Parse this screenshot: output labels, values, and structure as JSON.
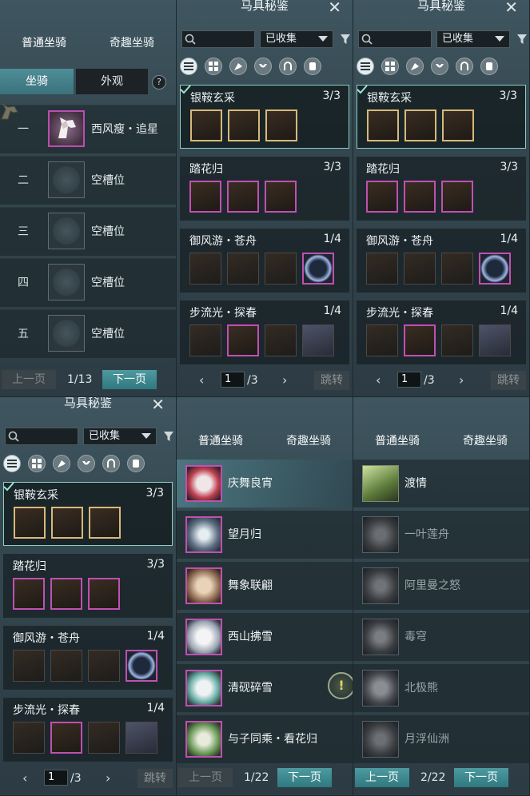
{
  "mount_list": {
    "tabs": [
      "普通坐骑",
      "奇趣坐骑"
    ],
    "sub_tabs": [
      "坐骑",
      "外观"
    ],
    "help": "?",
    "slots": [
      {
        "num": "一",
        "label": "西风瘦・追星",
        "filled": true
      },
      {
        "num": "二",
        "label": "空槽位",
        "filled": false
      },
      {
        "num": "三",
        "label": "空槽位",
        "filled": false
      },
      {
        "num": "四",
        "label": "空槽位",
        "filled": false
      },
      {
        "num": "五",
        "label": "空槽位",
        "filled": false
      }
    ],
    "pager": {
      "prev": "上一页",
      "page": "1/13",
      "next": "下一页"
    }
  },
  "codex": {
    "title": "马具秘鉴",
    "close": "✕",
    "filter_value": "已收集",
    "sets": [
      {
        "name": "银鞍玄采",
        "count": "3/3",
        "selected": true
      },
      {
        "name": "踏花归",
        "count": "3/3",
        "selected": false
      },
      {
        "name": "御风游・苍舟",
        "count": "1/4",
        "selected": false
      },
      {
        "name": "步流光・探春",
        "count": "1/4",
        "selected": false
      }
    ],
    "pager": {
      "page": "1",
      "total": "/3",
      "jump": "跳转"
    }
  },
  "mounts_page1": {
    "tabs": [
      "普通坐骑",
      "奇趣坐骑"
    ],
    "items": [
      "庆舞良宵",
      "望月归",
      "舞象联翩",
      "西山拂雪",
      "清砚碎雪",
      "与子同乘・看花归"
    ],
    "alert": "!",
    "pager": {
      "prev": "上一页",
      "page": "1/22",
      "next": "下一页"
    }
  },
  "mounts_page2": {
    "tabs": [
      "普通坐骑",
      "奇趣坐骑"
    ],
    "items": [
      "渡情",
      "一叶莲舟",
      "阿里曼之怒",
      "毒穹",
      "北极熊",
      "月浮仙洲"
    ],
    "pager": {
      "prev": "上一页",
      "page": "2/22",
      "next": "下一页"
    }
  },
  "colors": {
    "accent": "#3f8d93",
    "rare_border": "#c050b0",
    "gold_border": "#d7b97a"
  }
}
